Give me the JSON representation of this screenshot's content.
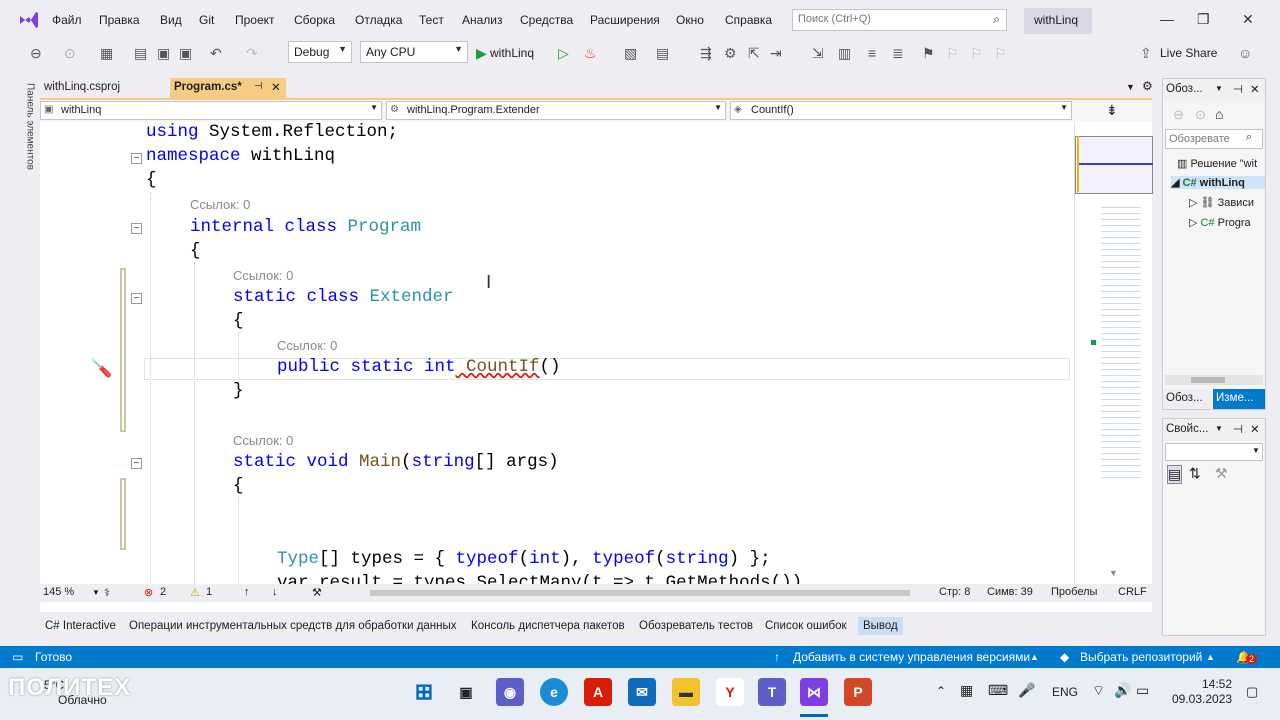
{
  "menu": {
    "items": [
      "Файл",
      "Правка",
      "Вид",
      "Git",
      "Проект",
      "Сборка",
      "Отладка",
      "Тест",
      "Анализ",
      "Средства",
      "Расширения",
      "Окно",
      "Справка"
    ],
    "search_placeholder": "Поиск (Ctrl+Q)",
    "solution_name": "withLinq"
  },
  "toolbar": {
    "config": "Debug",
    "platform": "Any CPU",
    "start_label": "withLinq",
    "live_share": "Live Share"
  },
  "left_panel": {
    "label": "Панель элементов"
  },
  "tabs": [
    {
      "label": "withLinq.csproj"
    },
    {
      "label": "Program.cs*"
    }
  ],
  "nav": {
    "project": "withLinq",
    "type": "withLinq.Program.Extender",
    "member": "CountIf()"
  },
  "code": {
    "l1_kw": "using",
    "l1_rest": " System.Reflection;",
    "l2_kw": "namespace",
    "l2_rest": " withLinq",
    "open1": "{",
    "refs1": "Ссылок: 0",
    "l4_kw": "internal class",
    "l4_type": " Program",
    "open2": "{",
    "refs2": "Ссылок: 0",
    "l6_kw": "static class",
    "l6_type": " Extender",
    "open3": "{",
    "refs3": "Ссылок: 0",
    "l8_kw": "public static int",
    "l8_fn": " CountIf",
    "l8_paren": "()",
    "close3": "}",
    "refs4": "Ссылок: 0",
    "l10_kw": "static void",
    "l10_fn": " Main",
    "l10_p1": "(",
    "l10_kw2": "string",
    "l10_p2": "[] args)",
    "open4": "{",
    "l12_type": "Type",
    "l12_mid": "[] types = { ",
    "l12_kw1": "typeof",
    "l12_a": "(",
    "l12_kw2": "int",
    "l12_b": "), ",
    "l12_kw3": "typeof",
    "l12_c": "(",
    "l12_kw4": "string",
    "l12_d": ") };",
    "l13": "var result = types.SelectMany(t => t.GetMethods())"
  },
  "editor_status": {
    "zoom": "145 %",
    "errors": "2",
    "warnings": "1",
    "line": "Стр: 8",
    "col": "Симв: 39",
    "spaces": "Пробелы",
    "eol": "CRLF"
  },
  "solution_panel": {
    "title": "Обоз...",
    "search": "Обозревате",
    "items": [
      "Решение \"wit",
      "withLinq",
      "Зависи",
      "Progra"
    ],
    "tab1": "Обоз...",
    "tab2": "Изме..."
  },
  "props_panel": {
    "title": "Свойс..."
  },
  "bottom_tabs": [
    "C# Interactive",
    "Операции инструментальных средств для обработки данных",
    "Консоль диспетчера пакетов",
    "Обозреватель тестов",
    "Список ошибок",
    "Вывод"
  ],
  "status": {
    "ready": "Готово",
    "vcs": "Добавить в систему управления версиями",
    "repo": "Выбрать репозиторий",
    "notif": "2"
  },
  "taskbar": {
    "weather_temp": "-5°C",
    "weather_text": "Облачно",
    "watermark": "ПОЛИТЕХ",
    "lang": "ENG",
    "time": "14:52",
    "date": "09.03.2023"
  },
  "colors": {
    "accent": "#007acc",
    "keyword": "#0000ff",
    "type": "#2b91af",
    "tab_active": "#f5cc84"
  }
}
